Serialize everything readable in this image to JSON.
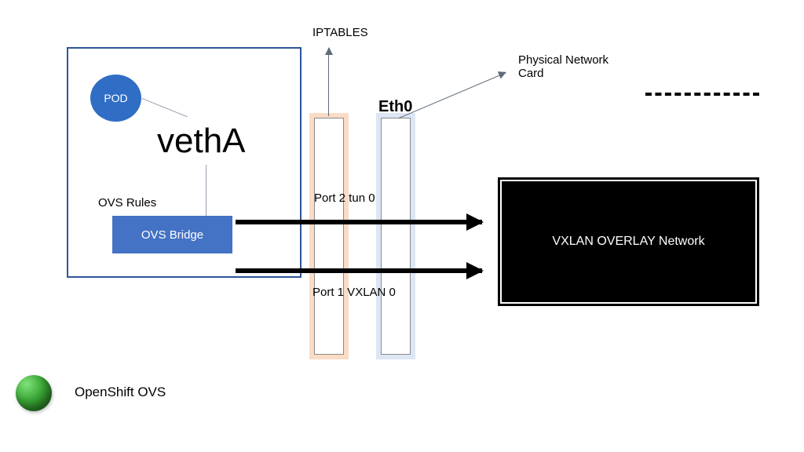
{
  "title": "OpenShift OVS",
  "node": {
    "pod_label": "POD",
    "vetha_label": "vethA",
    "ovs_rules_label": "OVS Rules",
    "ovs_bridge_label": "OVS Bridge"
  },
  "tun0": {
    "port2_label": "Port 2 tun 0",
    "port1_label": "Port 1 VXLAN 0",
    "iptables_label": "IPTABLES"
  },
  "eth0": {
    "label": "Eth0",
    "phys_card_label": "Physical Network\nCard"
  },
  "vxlan_overlay_label": "VXLAN OVERLAY Network"
}
